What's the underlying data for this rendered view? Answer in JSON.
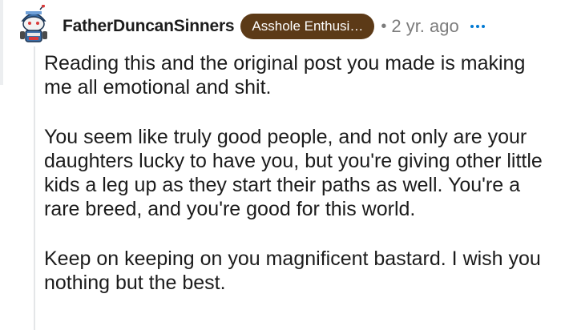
{
  "comment": {
    "username": "FatherDuncanSinners",
    "flair": "Asshole Enthusi…",
    "separator": "•",
    "age": "2 yr. ago",
    "more_icon": "more-horizontal-icon",
    "avatar_icon": "snoo-avatar-icon",
    "flair_color": "#5c3a17",
    "accent_color": "#0079d3",
    "paragraphs": [
      "Reading this and the original post you made is making me all emotional and shit.",
      "You seem like truly good people, and not only are your daughters lucky to have you, but you're giving other little kids a leg up as they start their paths as well. You're a rare breed, and you're good for this world.",
      "Keep on keeping on you magnificent bastard. I wish you nothing but the best."
    ]
  }
}
